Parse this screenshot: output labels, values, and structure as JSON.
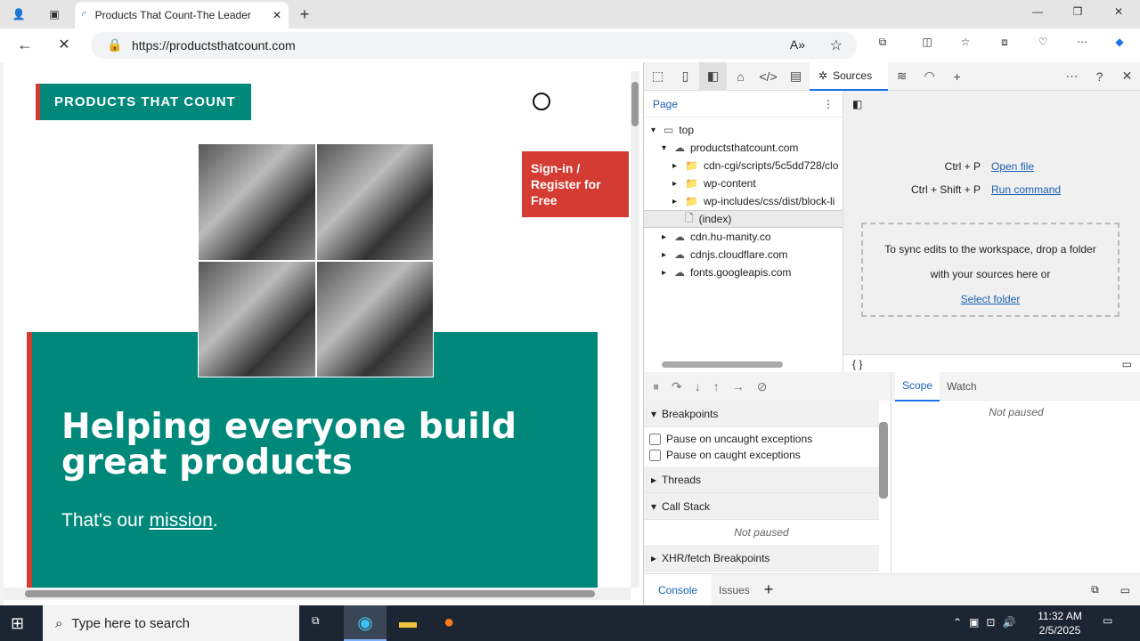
{
  "browser": {
    "tab_title": "Products That Count-The Leader",
    "url": "https://productsthatcount.com"
  },
  "page": {
    "logo": "PRODUCTS THAT COUNT",
    "signin": "Sign-in / Register for Free",
    "headline": "Helping everyone build great products",
    "mission_prefix": "That's our ",
    "mission_link": "mission",
    "mission_suffix": "."
  },
  "devtools": {
    "tabs": {
      "sources": "Sources"
    },
    "navigator_tab": "Page",
    "tree": [
      {
        "label": "top",
        "indent": 0
      },
      {
        "label": "productsthatcount.com",
        "indent": 1
      },
      {
        "label": "cdn-cgi/scripts/5c5dd728/clo",
        "indent": 2
      },
      {
        "label": "wp-content",
        "indent": 2
      },
      {
        "label": "wp-includes/css/dist/block-li",
        "indent": 2
      },
      {
        "label": "(index)",
        "indent": 2
      },
      {
        "label": "cdn.hu-manity.co",
        "indent": 1
      },
      {
        "label": "cdnjs.cloudflare.com",
        "indent": 1
      },
      {
        "label": "fonts.googleapis.com",
        "indent": 1
      }
    ],
    "shortcuts": [
      {
        "keys": "Ctrl + P",
        "action": "Open file"
      },
      {
        "keys": "Ctrl + Shift + P",
        "action": "Run command"
      }
    ],
    "drop_text": "To sync edits to the workspace, drop a folder with your sources here or",
    "select_folder": "Select folder",
    "breakpoints": "Breakpoints",
    "pause_uncaught": "Pause on uncaught exceptions",
    "pause_caught": "Pause on caught exceptions",
    "threads": "Threads",
    "call_stack": "Call Stack",
    "not_paused": "Not paused",
    "xhr": "XHR/fetch Breakpoints",
    "scope": "Scope",
    "watch": "Watch",
    "console": "Console",
    "issues": "Issues"
  },
  "taskbar": {
    "search": "Type here to search",
    "time": "11:32 AM",
    "date": "2/5/2025"
  }
}
